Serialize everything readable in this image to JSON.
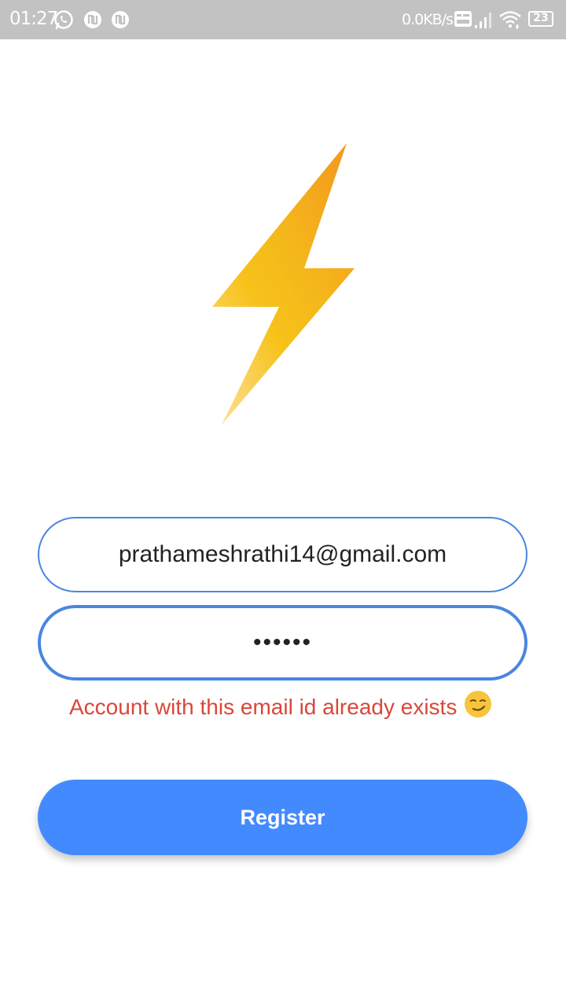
{
  "status_bar": {
    "time": "01:27",
    "net_speed": "0.0KB/s",
    "battery": "23",
    "background": "#c2c2c2"
  },
  "form": {
    "email_value": "prathameshrathi14@gmail.com",
    "password_masked": "••••••",
    "error_message": "Account with this email id already exists",
    "error_emoji": "😏",
    "register_label": "Register"
  },
  "colors": {
    "accent": "#448aff",
    "border": "#4a86e0",
    "error": "#d9473a",
    "logo": "#f5b50f"
  },
  "icons": [
    "whatsapp-icon",
    "notification-icon",
    "notification-icon",
    "volte-icon",
    "signal-icon",
    "wifi-icon",
    "battery-icon",
    "lightning-bolt-logo"
  ]
}
